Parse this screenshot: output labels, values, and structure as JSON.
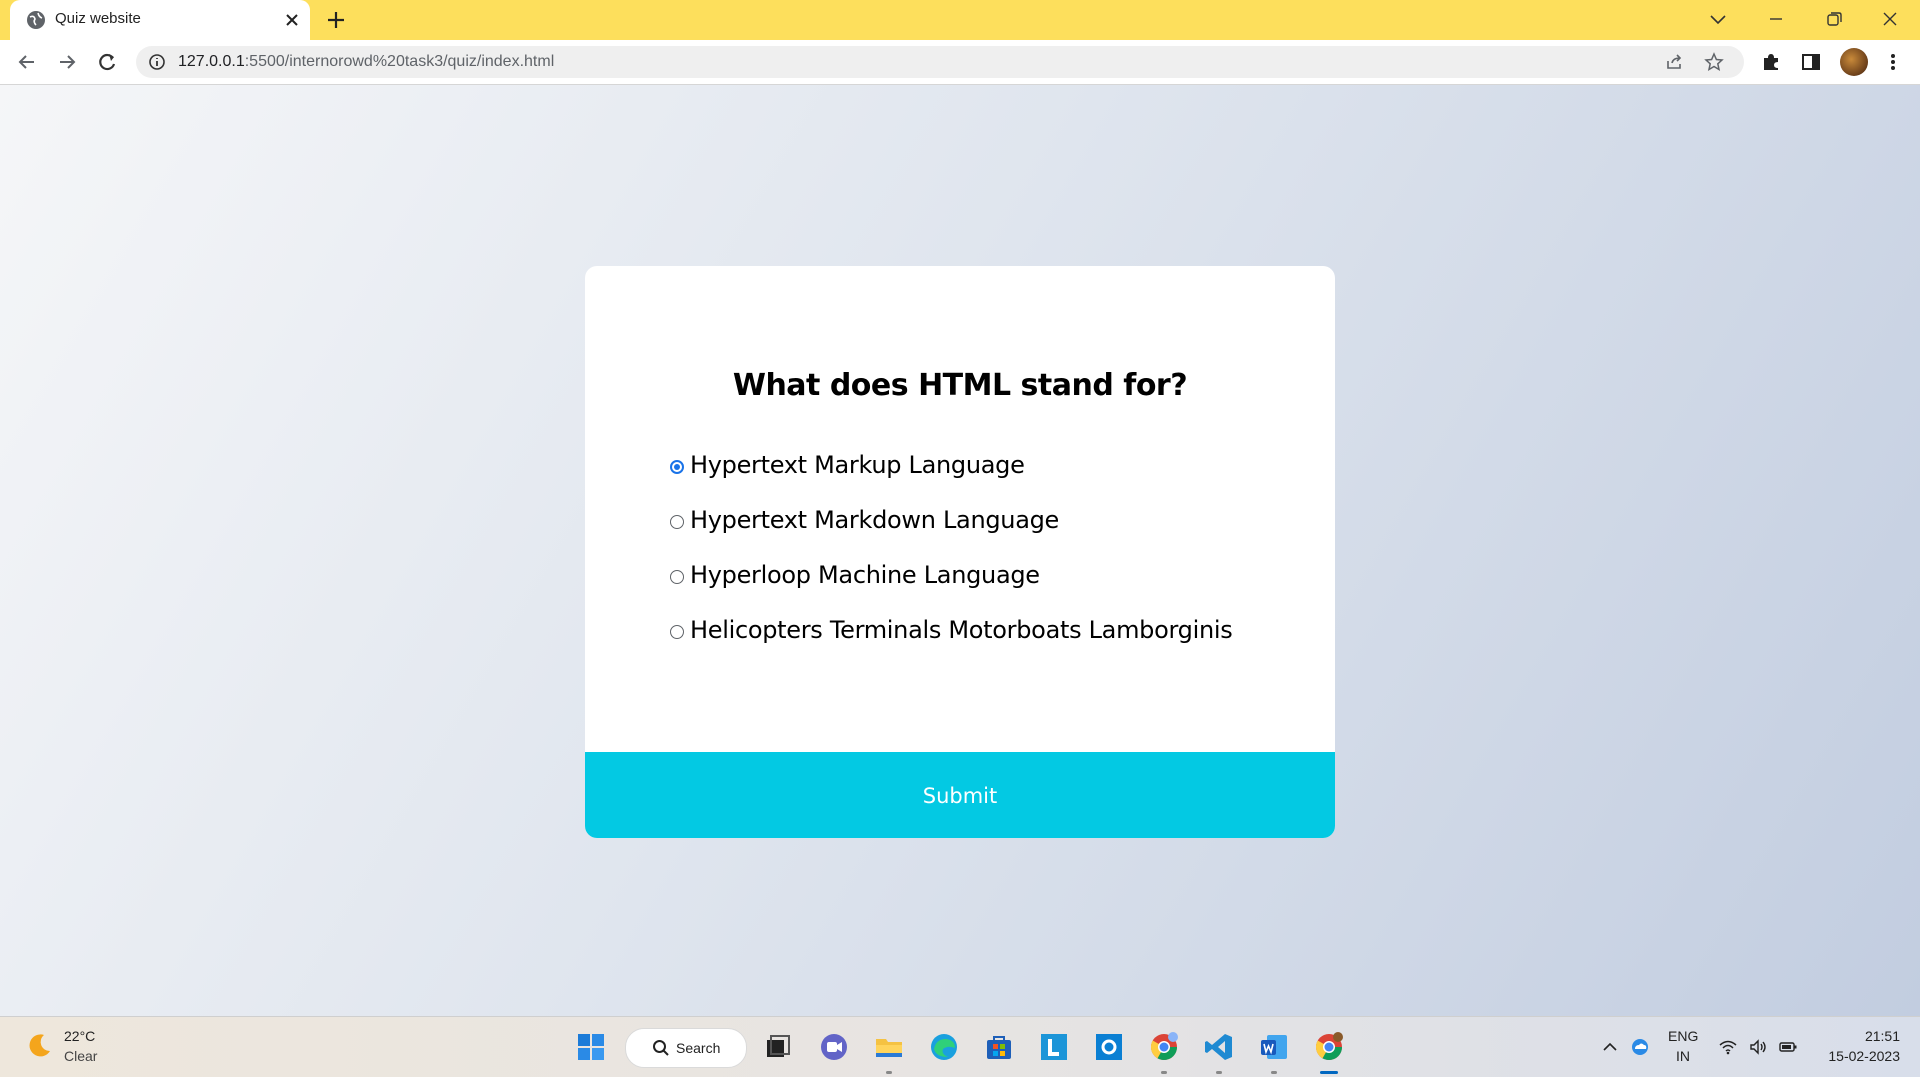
{
  "browser": {
    "tab_title": "Quiz website",
    "url_host": "127.0.0.1",
    "url_rest": ":5500/internorowd%20task3/quiz/index.html"
  },
  "quiz": {
    "question": "What does HTML stand for?",
    "answers": [
      {
        "label": "Hypertext Markup Language",
        "selected": true
      },
      {
        "label": "Hypertext Markdown Language",
        "selected": false
      },
      {
        "label": "Hyperloop Machine Language",
        "selected": false
      },
      {
        "label": "Helicopters Terminals Motorboats Lamborginis",
        "selected": false
      }
    ],
    "submit_label": "Submit",
    "submit_color": "#03c9e3"
  },
  "taskbar": {
    "weather_temp": "22°C",
    "weather_cond": "Clear",
    "search_label": "Search",
    "lang_line1": "ENG",
    "lang_line2": "IN",
    "time": "21:51",
    "date": "15-02-2023"
  },
  "colors": {
    "tab_strip": "#fddf5c",
    "accent": "#1a73e8"
  }
}
